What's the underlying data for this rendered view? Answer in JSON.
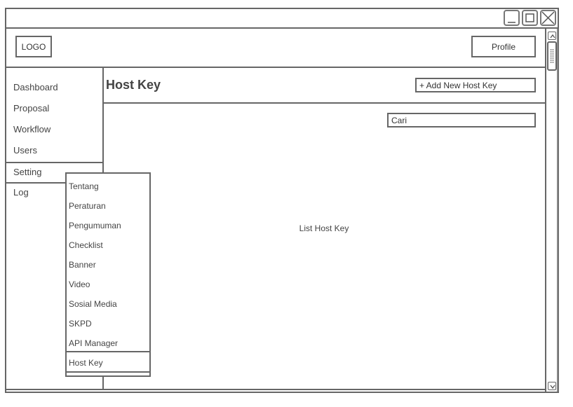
{
  "window": {
    "controls": [
      "minimize-icon",
      "maximize-icon",
      "close-icon"
    ]
  },
  "header": {
    "logo": "LOGO",
    "profile": "Profile"
  },
  "sidebar": {
    "items": [
      "Dashboard",
      "Proposal",
      "Workflow",
      "Users",
      "Setting",
      "Log"
    ],
    "selected": "Setting"
  },
  "setting_menu": {
    "items": [
      "Tentang",
      "Peraturan",
      "Pengumuman",
      "Checklist",
      "Banner",
      "Video",
      "Sosial Media",
      "SKPD",
      "API Manager",
      "Host Key"
    ],
    "selected": "Host Key"
  },
  "main": {
    "title": "Host Key",
    "add_button": "+ Add New Host Key",
    "search_placeholder": "Cari",
    "list_label": "List Host Key"
  }
}
